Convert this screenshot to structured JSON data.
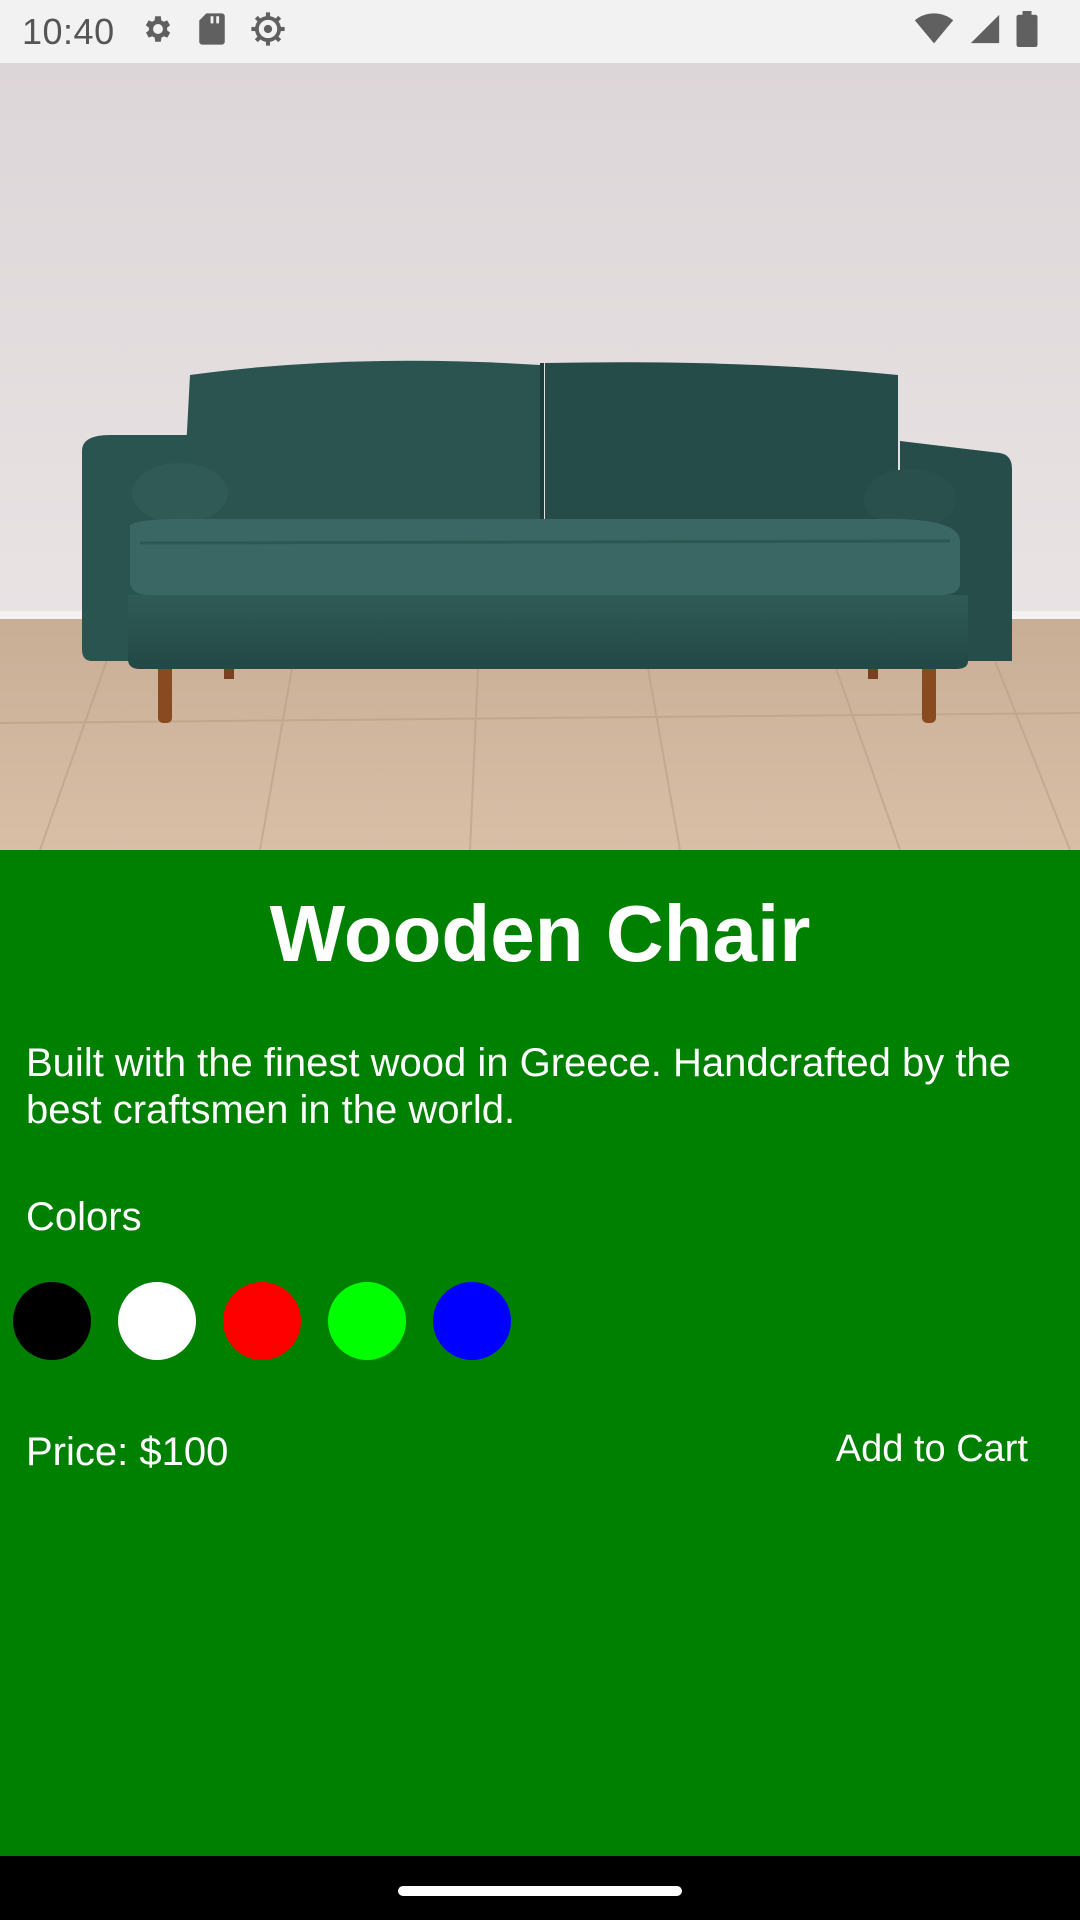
{
  "status_bar": {
    "time": "10:40",
    "icons_left": [
      "gear-icon",
      "sd-card-icon",
      "sync-gear-icon"
    ],
    "icons_right": [
      "wifi-icon",
      "cell-signal-icon",
      "battery-icon"
    ]
  },
  "hero": {
    "image": "green-velvet-sofa-photo"
  },
  "product": {
    "title": "Wooden Chair",
    "description": "Built with the finest wood in Greece. Handcrafted by the best craftsmen in the world.",
    "colors_label": "Colors",
    "colors": [
      {
        "name": "black",
        "hex": "#000000"
      },
      {
        "name": "white",
        "hex": "#ffffff"
      },
      {
        "name": "red",
        "hex": "#ff0000"
      },
      {
        "name": "green",
        "hex": "#00ff00"
      },
      {
        "name": "blue",
        "hex": "#0000ff"
      }
    ],
    "price_label": "Price: $100",
    "add_to_cart_label": "Add to Cart"
  },
  "theme": {
    "panel_background": "#008000",
    "text_color": "#ffffff"
  }
}
